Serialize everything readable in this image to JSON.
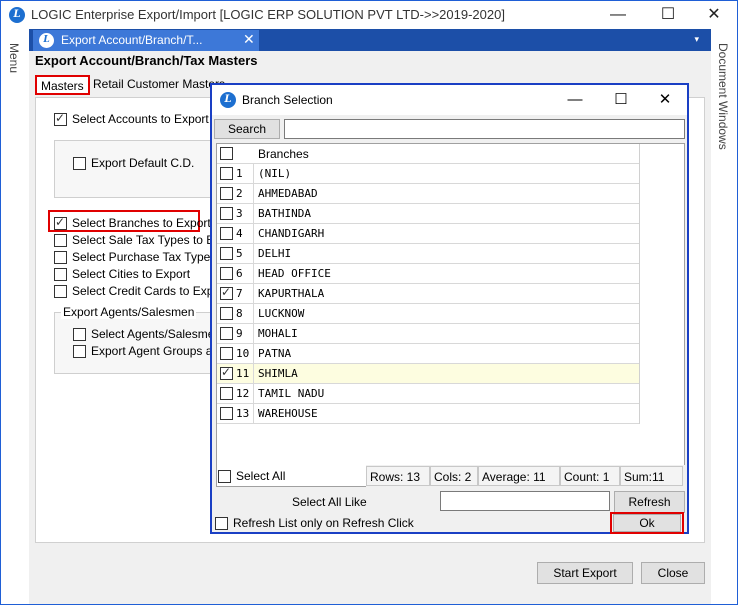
{
  "app": {
    "title": "LOGIC Enterprise Export/Import  [LOGIC ERP SOLUTION PVT LTD->>2019-2020]",
    "logo_letter": "L",
    "minimize": "—",
    "maximize": "☐",
    "close": "✕"
  },
  "side": {
    "left_label": "Menu",
    "right_label": "Document Windows"
  },
  "doc_tab": {
    "label": "Export Account/Branch/T...",
    "close": "✕",
    "overflow": "▾"
  },
  "form": {
    "title": "Export Account/Branch/Tax Masters",
    "tabs": [
      "Masters",
      "Retail Customer Masters"
    ],
    "options": {
      "select_accounts": "Select Accounts to Export",
      "export_default_cd": "Export Default C.D.",
      "select_branches": "Select Branches to Export",
      "select_sale_tax": "Select Sale Tax Types to Exp",
      "select_purchase_tax": "Select Purchase Tax Types t",
      "select_cities": "Select Cities to Export",
      "select_credit_cards": "Select Credit Cards to Export"
    },
    "agents_group": {
      "legend": "Export Agents/Salesmen",
      "select_agents": "Select Agents/Salesmen",
      "export_agent_groups": "Export Agent Groups also"
    },
    "start_export": "Start Export",
    "close": "Close"
  },
  "dialog": {
    "title": "Branch Selection",
    "search_label": "Search",
    "search_value": "",
    "header": "Branches",
    "rows": [
      {
        "n": "1",
        "name": "(NIL)",
        "checked": false
      },
      {
        "n": "2",
        "name": "AHMEDABAD",
        "checked": false
      },
      {
        "n": "3",
        "name": "BATHINDA",
        "checked": false
      },
      {
        "n": "4",
        "name": "CHANDIGARH",
        "checked": false
      },
      {
        "n": "5",
        "name": "DELHI",
        "checked": false
      },
      {
        "n": "6",
        "name": "HEAD OFFICE",
        "checked": false
      },
      {
        "n": "7",
        "name": "KAPURTHALA",
        "checked": true
      },
      {
        "n": "8",
        "name": "LUCKNOW",
        "checked": false
      },
      {
        "n": "9",
        "name": "MOHALI",
        "checked": false
      },
      {
        "n": "10",
        "name": "PATNA",
        "checked": false
      },
      {
        "n": "11",
        "name": "SHIMLA",
        "checked": true
      },
      {
        "n": "12",
        "name": "TAMIL NADU",
        "checked": false
      },
      {
        "n": "13",
        "name": "WAREHOUSE",
        "checked": false
      }
    ],
    "select_all": "Select All",
    "status": {
      "rows": "Rows: 13",
      "cols": "Cols: 2",
      "average": "Average: 11",
      "count": "Count: 1",
      "sum": "Sum:11"
    },
    "select_all_like": "Select All Like",
    "select_all_like_value": "",
    "refresh": "Refresh",
    "refresh_on_click": "Refresh List only on Refresh Click",
    "ok": "Ok"
  }
}
